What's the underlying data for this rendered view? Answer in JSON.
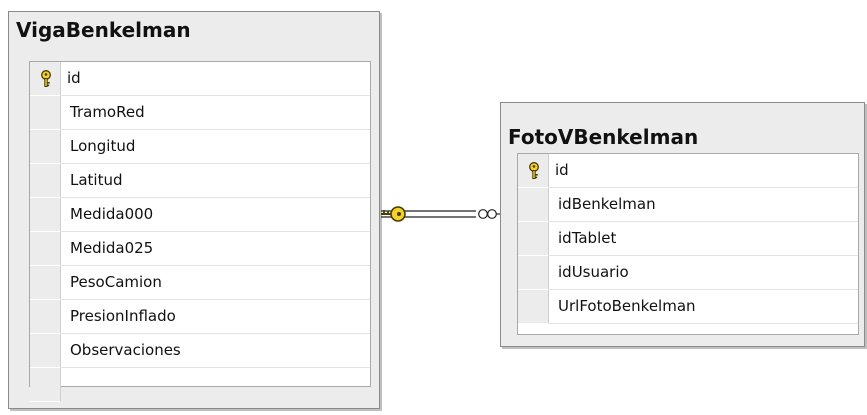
{
  "tables": [
    {
      "name": "VigaBenkelman",
      "columns": [
        {
          "name": "id",
          "primary_key": true
        },
        {
          "name": "TramoRed",
          "primary_key": false
        },
        {
          "name": "Longitud",
          "primary_key": false
        },
        {
          "name": "Latitud",
          "primary_key": false
        },
        {
          "name": "Medida000",
          "primary_key": false
        },
        {
          "name": "Medida025",
          "primary_key": false
        },
        {
          "name": "PesoCamion",
          "primary_key": false
        },
        {
          "name": "PresionInflado",
          "primary_key": false
        },
        {
          "name": "Observaciones",
          "primary_key": false
        }
      ]
    },
    {
      "name": "FotoVBenkelman",
      "columns": [
        {
          "name": "id",
          "primary_key": true
        },
        {
          "name": "idBenkelman",
          "primary_key": false
        },
        {
          "name": "idTablet",
          "primary_key": false
        },
        {
          "name": "idUsuario",
          "primary_key": false
        },
        {
          "name": "UrlFotoBenkelman",
          "primary_key": false
        }
      ]
    }
  ],
  "relationship": {
    "from": "VigaBenkelman",
    "to": "FotoVBenkelman",
    "from_end": "key-icon",
    "to_end": "infinity-icon"
  },
  "colors": {
    "key": "#f2d22e",
    "key_outline": "#4a3b00",
    "line": "#222222"
  }
}
